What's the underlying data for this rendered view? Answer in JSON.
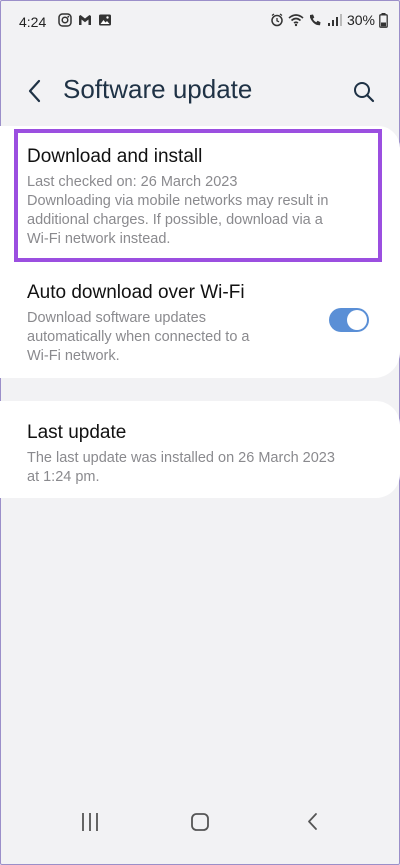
{
  "status_bar": {
    "time": "4:24",
    "battery": "30%",
    "icons": [
      "instagram-icon",
      "gmail-icon",
      "gallery-icon",
      "alarm-icon",
      "wifi-icon",
      "call-icon",
      "signal-icon",
      "battery-icon"
    ]
  },
  "header": {
    "title": "Software update",
    "back_icon": "back-chevron-icon",
    "search_icon": "search-icon"
  },
  "card1": {
    "download": {
      "title": "Download and install",
      "line1": "Last checked on: 26 March 2023",
      "line2": "Downloading via mobile networks may result in",
      "line3": "additional charges. If possible, download via a",
      "line4": "Wi-Fi network instead."
    },
    "auto": {
      "title": "Auto download over Wi-Fi",
      "line1": "Download software updates",
      "line2": "automatically when connected to a",
      "line3": "Wi-Fi network.",
      "toggle_on": true
    }
  },
  "card2": {
    "title": "Last update",
    "line1": "The last update was installed on 26 March 2023",
    "line2": "at 1:24 pm."
  },
  "colors": {
    "highlight": "#9b4fe0",
    "toggle": "#5a8fd6",
    "title": "#1f3245"
  },
  "nav_bar": [
    "recents-icon",
    "home-icon",
    "back-icon"
  ]
}
